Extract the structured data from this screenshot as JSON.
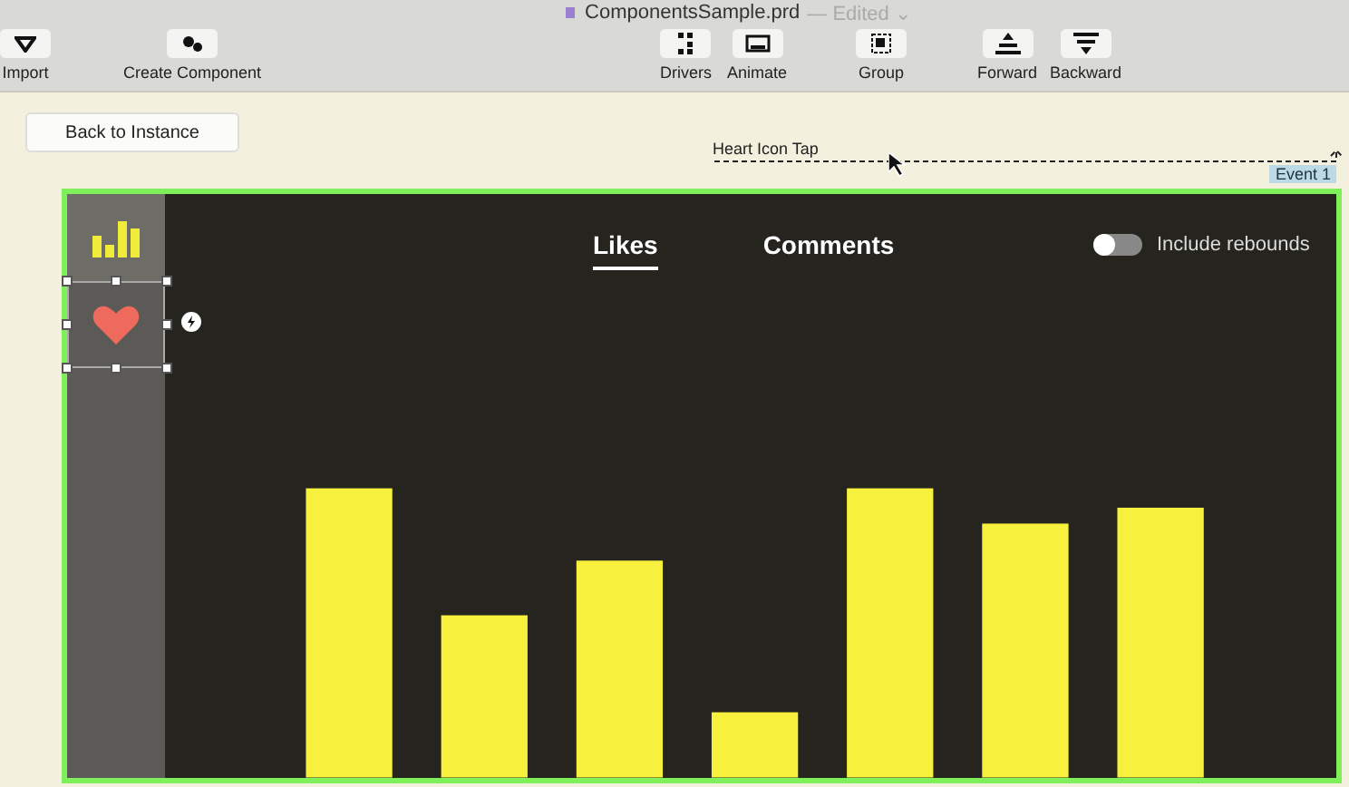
{
  "window": {
    "title": "ComponentsSample.prd",
    "status": "— Edited ⌄"
  },
  "toolbar": [
    {
      "kind": "import",
      "label": "Import"
    },
    {
      "kind": "component",
      "label": "Create Component"
    },
    {
      "kind": "drivers",
      "label": "Drivers"
    },
    {
      "kind": "animate",
      "label": "Animate"
    },
    {
      "kind": "group",
      "label": "Group"
    },
    {
      "kind": "forward",
      "label": "Forward"
    },
    {
      "kind": "backward",
      "label": "Backward"
    }
  ],
  "back_button": "Back to Instance",
  "event": {
    "label": "Heart Icon Tap",
    "tag": "Event 1"
  },
  "sidebar": {
    "items": [
      {
        "kind": "chart",
        "active": true,
        "selected": false
      },
      {
        "kind": "heart",
        "active": false,
        "selected": true
      }
    ]
  },
  "tabs": [
    {
      "label": "Likes",
      "selected": true
    },
    {
      "label": "Comments",
      "selected": false
    }
  ],
  "toggle": {
    "label": "Include rebounds",
    "on": false
  }
}
